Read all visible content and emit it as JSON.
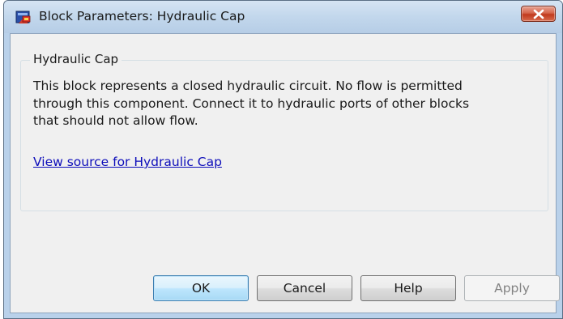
{
  "window": {
    "title": "Block Parameters: Hydraulic Cap",
    "icon": "simulink-block-icon",
    "close_icon": "close-icon"
  },
  "group": {
    "title": "Hydraulic Cap",
    "description_lines": [
      "This block represents a closed hydraulic circuit. No flow is permitted",
      "through this component.  Connect it to hydraulic ports of other blocks",
      "that should not allow flow."
    ],
    "link": "View source for Hydraulic Cap"
  },
  "buttons": {
    "ok": "OK",
    "cancel": "Cancel",
    "help": "Help",
    "apply": "Apply"
  },
  "colors": {
    "link": "#0d0dba",
    "close_button": "#c7442a",
    "default_button_border": "#3c7fb1"
  }
}
